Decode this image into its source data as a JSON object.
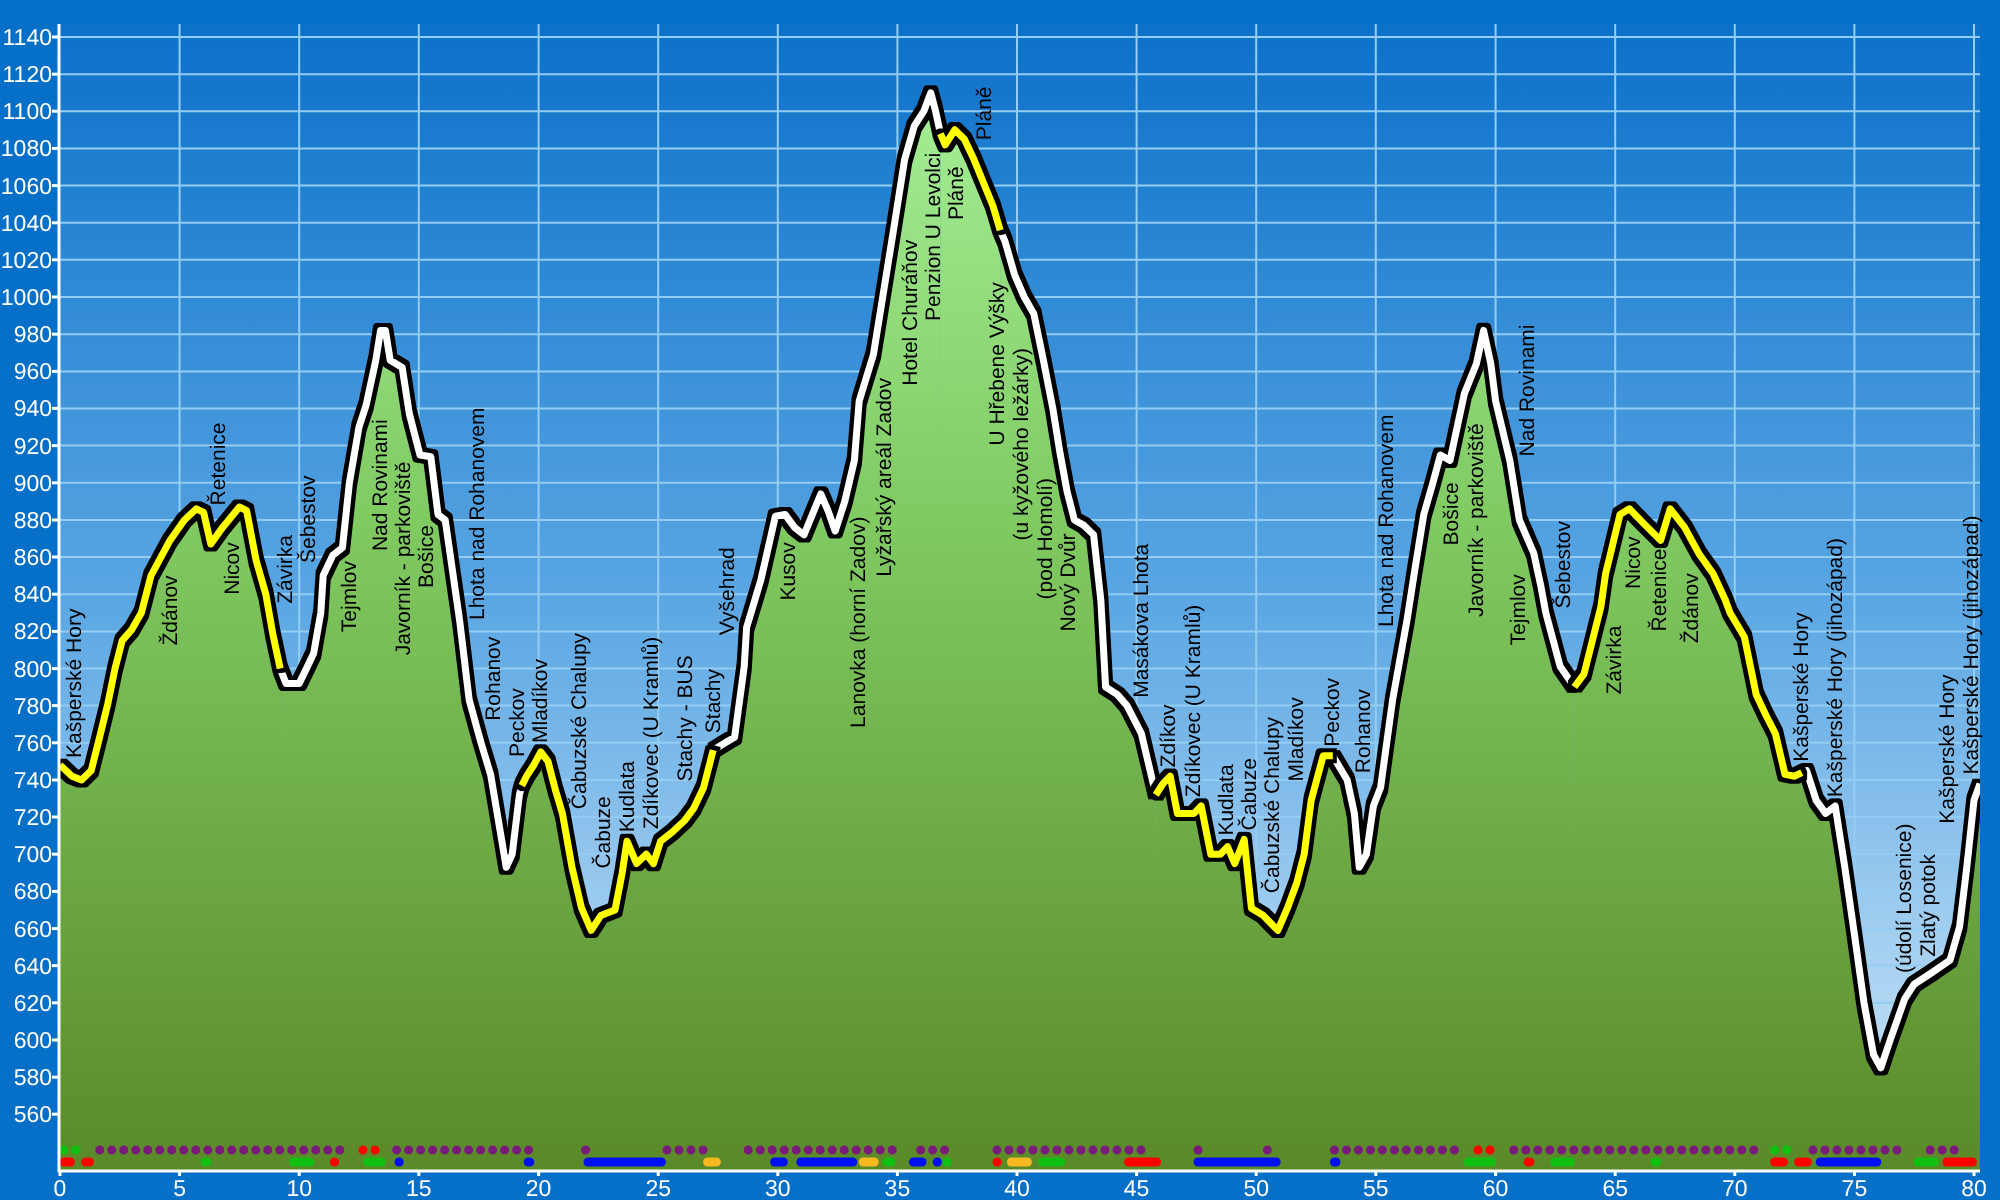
{
  "chart_data": {
    "type": "area",
    "grid": true,
    "x": [
      0,
      0.5,
      0.9,
      1.3,
      1.6,
      2.0,
      2.3,
      2.6,
      3.0,
      3.4,
      3.8,
      4.6,
      5.2,
      5.7,
      6.0,
      6.3,
      6.8,
      7.5,
      7.8,
      8.2,
      8.6,
      8.9,
      9.2,
      9.45,
      10.0,
      10.3,
      10.6,
      10.9,
      11.0,
      11.4,
      11.8,
      12.1,
      12.5,
      12.8,
      13.2,
      13.4,
      13.6,
      13.8,
      14.3,
      14.6,
      15.05,
      15.5,
      15.8,
      16.1,
      16.5,
      16.7,
      17.1,
      17.6,
      18.0,
      18.3,
      18.65,
      18.9,
      19.2,
      19.3,
      19.5,
      19.8,
      20.1,
      20.4,
      20.7,
      21.0,
      21.4,
      21.8,
      22.2,
      22.6,
      23.2,
      23.5,
      23.7,
      24.1,
      24.5,
      24.8,
      25.1,
      25.6,
      26.1,
      26.5,
      26.9,
      27.3,
      27.8,
      28.2,
      28.6,
      28.7,
      29.3,
      29.9,
      30.3,
      30.7,
      31.1,
      31.8,
      32.1,
      32.4,
      32.8,
      33.2,
      33.4,
      34.0,
      34.4,
      34.9,
      35.3,
      35.7,
      36.1,
      36.4,
      36.6,
      36.8,
      37.0,
      37.4,
      37.8,
      38.2,
      39.0,
      39.3,
      39.5,
      39.9,
      40.3,
      40.7,
      41.1,
      41.5,
      41.8,
      42.1,
      42.4,
      42.8,
      43.2,
      43.5,
      43.7,
      44.2,
      44.6,
      45.2,
      45.8,
      46.1,
      46.4,
      46.7,
      47.4,
      47.7,
      48.1,
      48.5,
      48.8,
      49.1,
      49.5,
      49.8,
      50.3,
      50.6,
      50.9,
      51.3,
      51.7,
      52.0,
      52.3,
      52.8,
      53.2,
      53.8,
      54.1,
      54.3,
      54.6,
      54.9,
      55.2,
      55.7,
      56.3,
      56.6,
      57.0,
      57.4,
      57.7,
      58.1,
      58.7,
      59.2,
      59.5,
      59.8,
      60.0,
      60.6,
      61.0,
      61.6,
      61.9,
      62.1,
      62.7,
      63.3,
      63.7,
      64.4,
      64.6,
      65.2,
      65.6,
      66.2,
      66.9,
      67.3,
      67.9,
      68.5,
      69.1,
      69.6,
      69.8,
      70.4,
      70.9,
      71.3,
      71.7,
      72.1,
      72.5,
      72.8,
      73.0,
      73.4,
      73.8,
      74.2,
      74.6,
      75.0,
      75.4,
      75.8,
      76.1,
      76.5,
      77.1,
      77.5,
      78.2,
      79.0,
      79.4,
      79.7,
      80.0,
      80.25
    ],
    "series": [
      {
        "color": "#ffffff",
        "values": [
          null,
          null,
          null,
          null,
          null,
          null,
          null,
          null,
          null,
          null,
          null,
          null,
          null,
          null,
          null,
          null,
          null,
          null,
          null,
          null,
          null,
          null,
          800,
          792,
          792,
          800,
          808,
          830,
          850,
          861,
          865,
          900,
          930,
          942,
          966,
          982,
          982,
          966,
          962,
          937,
          915,
          914,
          883,
          880,
          844,
          826,
          783,
          760,
          743,
          720,
          693,
          700,
          732,
          737,
          null,
          null,
          null,
          null,
          null,
          null,
          null,
          null,
          null,
          null,
          null,
          null,
          null,
          null,
          null,
          null,
          null,
          null,
          null,
          null,
          null,
          756,
          760,
          763,
          801,
          822,
          848,
          882,
          883,
          876,
          872,
          894,
          885,
          874,
          890,
          912,
          944,
          969,
          1001,
          1041,
          1074,
          1092,
          1100,
          1110,
          1100,
          1088,
          null,
          null,
          null,
          null,
          null,
          1036,
          1030,
          1012,
          1000,
          991,
          966,
          940,
          916,
          895,
          880,
          877,
          872,
          837,
          790,
          786,
          780,
          765,
          732,
          null,
          null,
          null,
          null,
          null,
          null,
          null,
          null,
          null,
          null,
          null,
          null,
          null,
          null,
          null,
          null,
          null,
          null,
          null,
          753,
          740,
          722,
          693,
          700,
          726,
          736,
          783,
          826,
          851,
          883,
          901,
          915,
          912,
          948,
          964,
          982,
          964,
          944,
          912,
          880,
          862,
          844,
          830,
          801,
          790,
          null,
          null,
          null,
          null,
          null,
          null,
          null,
          null,
          null,
          null,
          null,
          null,
          null,
          null,
          null,
          null,
          null,
          null,
          null,
          744,
          745,
          729,
          722,
          726,
          693,
          657,
          620,
          592,
          585,
          600,
          622,
          630,
          636,
          643,
          661,
          693,
          729,
          738
        ]
      },
      {
        "color": "#ffff00",
        "values": [
          748,
          742,
          740,
          745,
          760,
          781,
          800,
          815,
          821,
          830,
          850,
          869,
          880,
          886,
          884,
          867,
          876,
          887,
          885,
          858,
          840,
          818,
          800,
          null,
          null,
          null,
          null,
          null,
          null,
          null,
          null,
          null,
          null,
          null,
          null,
          null,
          null,
          null,
          null,
          null,
          null,
          null,
          null,
          null,
          null,
          null,
          null,
          null,
          null,
          null,
          null,
          null,
          null,
          737,
          742,
          748,
          755,
          750,
          735,
          722,
          693,
          671,
          659,
          667,
          670,
          690,
          707,
          695,
          700,
          695,
          707,
          712,
          718,
          725,
          736,
          756,
          null,
          null,
          null,
          null,
          null,
          null,
          null,
          null,
          null,
          null,
          null,
          null,
          null,
          null,
          null,
          null,
          null,
          null,
          null,
          null,
          null,
          null,
          null,
          1088,
          1082,
          1090,
          1085,
          1074,
          1049,
          1036,
          null,
          null,
          null,
          null,
          null,
          null,
          null,
          null,
          null,
          null,
          null,
          null,
          null,
          null,
          null,
          null,
          732,
          738,
          742,
          722,
          722,
          726,
          700,
          700,
          704,
          695,
          708,
          671,
          667,
          663,
          659,
          671,
          685,
          700,
          729,
          753,
          753,
          null,
          null,
          null,
          null,
          null,
          null,
          null,
          null,
          null,
          null,
          null,
          null,
          null,
          null,
          null,
          null,
          null,
          null,
          null,
          null,
          null,
          null,
          null,
          null,
          790,
          797,
          833,
          851,
          883,
          886,
          878,
          869,
          886,
          876,
          862,
          851,
          837,
          830,
          817,
          786,
          775,
          765,
          743,
          742,
          744,
          null,
          null,
          null,
          null,
          null,
          null,
          null,
          null,
          null,
          null,
          null,
          null,
          null,
          null,
          null,
          null,
          null,
          null
        ]
      }
    ],
    "xlim": [
      0,
      80.25
    ],
    "ylim": [
      530,
      1147
    ],
    "xticks": [
      0,
      5,
      10,
      15,
      20,
      25,
      30,
      35,
      40,
      45,
      50,
      55,
      60,
      65,
      70,
      75,
      80
    ],
    "yticks": [
      560,
      580,
      600,
      620,
      640,
      660,
      680,
      700,
      720,
      740,
      760,
      780,
      800,
      820,
      840,
      860,
      880,
      900,
      920,
      940,
      960,
      980,
      1000,
      1020,
      1040,
      1060,
      1080,
      1100,
      1120,
      1140
    ],
    "annotations": [
      {
        "text": "Kašperské Hory",
        "x": 0.5,
        "y": 742
      },
      {
        "text": "Ždánov",
        "x": 3.9,
        "y": 852
      },
      {
        "text": "Řetenice",
        "x": 6.02,
        "y": 883
      },
      {
        "text": "Nicov",
        "x": 7.36,
        "y": 885
      },
      {
        "text": "Závirka",
        "x": 8.7,
        "y": 833
      },
      {
        "text": "Šebestov",
        "x": 11.0,
        "y": 850
      },
      {
        "text": "Tejmlov",
        "x": 11.45,
        "y": 861
      },
      {
        "text": "Nad Rovinami",
        "x": 12.62,
        "y": 935
      },
      {
        "text": "Javorník - parkoviště",
        "x": 14.8,
        "y": 927
      },
      {
        "text": "Bošice",
        "x": 16.1,
        "y": 880
      },
      {
        "text": "Lhota nad Rohanovem",
        "x": 16.72,
        "y": 824
      },
      {
        "text": "Rohanov",
        "x": 17.39,
        "y": 770
      },
      {
        "text": "Peckov",
        "x": 19.64,
        "y": 745
      },
      {
        "text": "Mladíkov",
        "x": 20.1,
        "y": 755
      },
      {
        "text": "Čabuzské Chalupy",
        "x": 21.0,
        "y": 722
      },
      {
        "text": "Čabuze",
        "x": 23.5,
        "y": 690
      },
      {
        "text": "Kudlata",
        "x": 23.7,
        "y": 707
      },
      {
        "text": "Zdíkovec (U Kramlů)",
        "x": 25.1,
        "y": 707
      },
      {
        "text": "Stachy - BUS",
        "x": 26.92,
        "y": 737
      },
      {
        "text": "Stachy",
        "x": 27.95,
        "y": 761
      },
      {
        "text": "Vyšehrad",
        "x": 28.67,
        "y": 816
      },
      {
        "text": "Kusov",
        "x": 30.26,
        "y": 883
      },
      {
        "text": "Lanovka (horní Zadov)",
        "x": 32.65,
        "y": 884
      },
      {
        "text": "Lyžařský areál Zadov",
        "x": 33.75,
        "y": 957
      },
      {
        "text": "Hotel Churáňov",
        "x": 34.8,
        "y": 1032
      },
      {
        "text": "Penzion U Levolci",
        "x": 35.85,
        "y": 1095
      },
      {
        "text": "Pláně",
        "x": 36.95,
        "y": 1084
      },
      {
        "text": "Pláně",
        "x": 37.9,
        "y": 1082
      },
      {
        "text": "U Hřebene Výšky",
        "x": 39.96,
        "y": 1010
      },
      {
        "text": "(u kyžového ležárky)",
        "x": 40.96,
        "y": 975
      },
      {
        "text": "(pod Homolí)",
        "x": 41.96,
        "y": 905
      },
      {
        "text": "Nový Dvůr",
        "x": 42.6,
        "y": 878
      },
      {
        "text": "Masákova Lhota",
        "x": 44.56,
        "y": 781
      },
      {
        "text": "Zdíkov",
        "x": 45.81,
        "y": 732
      },
      {
        "text": "Zdíkovec (U Kramlů)",
        "x": 47.4,
        "y": 722
      },
      {
        "text": "Kudlata",
        "x": 48.8,
        "y": 704
      },
      {
        "text": "Čabuze",
        "x": 49.5,
        "y": 708
      },
      {
        "text": "Čabuzské Chalupy",
        "x": 51.3,
        "y": 671
      },
      {
        "text": "Mladíkov",
        "x": 52.3,
        "y": 729
      },
      {
        "text": "Peckov",
        "x": 53.2,
        "y": 753
      },
      {
        "text": "Rohanov",
        "x": 55.2,
        "y": 736
      },
      {
        "text": "Lhota nad Rohanovem",
        "x": 56.26,
        "y": 823
      },
      {
        "text": "Bošice",
        "x": 57.43,
        "y": 902
      },
      {
        "text": "Javorník - parkoviště",
        "x": 58.43,
        "y": 932
      },
      {
        "text": "Nad Rovinami",
        "x": 60.6,
        "y": 912
      },
      {
        "text": "Tejmlov",
        "x": 61.75,
        "y": 853
      },
      {
        "text": "Šebestov",
        "x": 62.1,
        "y": 830
      },
      {
        "text": "Závirka",
        "x": 64.25,
        "y": 825
      },
      {
        "text": "Nicov",
        "x": 65.45,
        "y": 885
      },
      {
        "text": "Řetenice",
        "x": 66.87,
        "y": 869
      },
      {
        "text": "Ždánov",
        "x": 68.96,
        "y": 854
      },
      {
        "text": "Kašperské Hory",
        "x": 72.81,
        "y": 744
      },
      {
        "text": "Kašperské Hory (jihozápad)",
        "x": 73.81,
        "y": 722
      },
      {
        "text": "(údolí Losenice)",
        "x": 77.74,
        "y": 632
      },
      {
        "text": "Zlatý potok",
        "x": 78.74,
        "y": 641
      },
      {
        "text": "Kašperské Hory (jihozápad)",
        "x": 80.25,
        "y": 738
      },
      {
        "text": "Kašperské Hory",
        "x": 79.8,
        "y": 705
      }
    ]
  }
}
